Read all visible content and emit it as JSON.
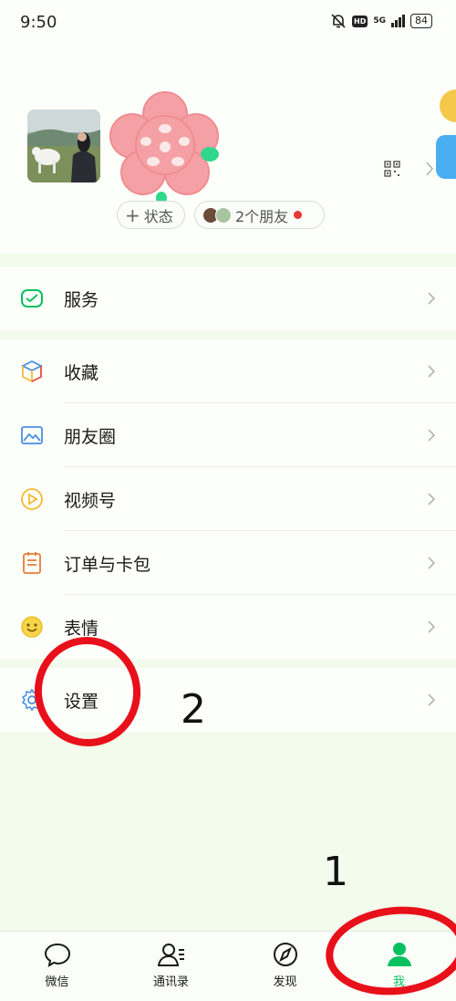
{
  "status_bar": {
    "time": "9:50",
    "hd": "HD",
    "network": "5G",
    "battery": "84"
  },
  "profile": {
    "status_button": {
      "plus": "+",
      "label": "状态"
    },
    "friends_button": {
      "label": "2个朋友"
    }
  },
  "menu": {
    "services": "服务",
    "favorites": "收藏",
    "moments": "朋友圈",
    "channels": "视频号",
    "orders": "订单与卡包",
    "stickers": "表情",
    "settings": "设置"
  },
  "tabs": [
    {
      "label": "微信",
      "icon": "chat-bubble-icon"
    },
    {
      "label": "通讯录",
      "icon": "contacts-icon"
    },
    {
      "label": "发现",
      "icon": "compass-icon"
    },
    {
      "label": "我",
      "icon": "person-icon"
    }
  ],
  "annotations": {
    "step1": "1",
    "step2": "2"
  },
  "colors": {
    "accent": "#07c160",
    "annotation_red": "#e8101a",
    "page_bg": "#f3fbec"
  }
}
